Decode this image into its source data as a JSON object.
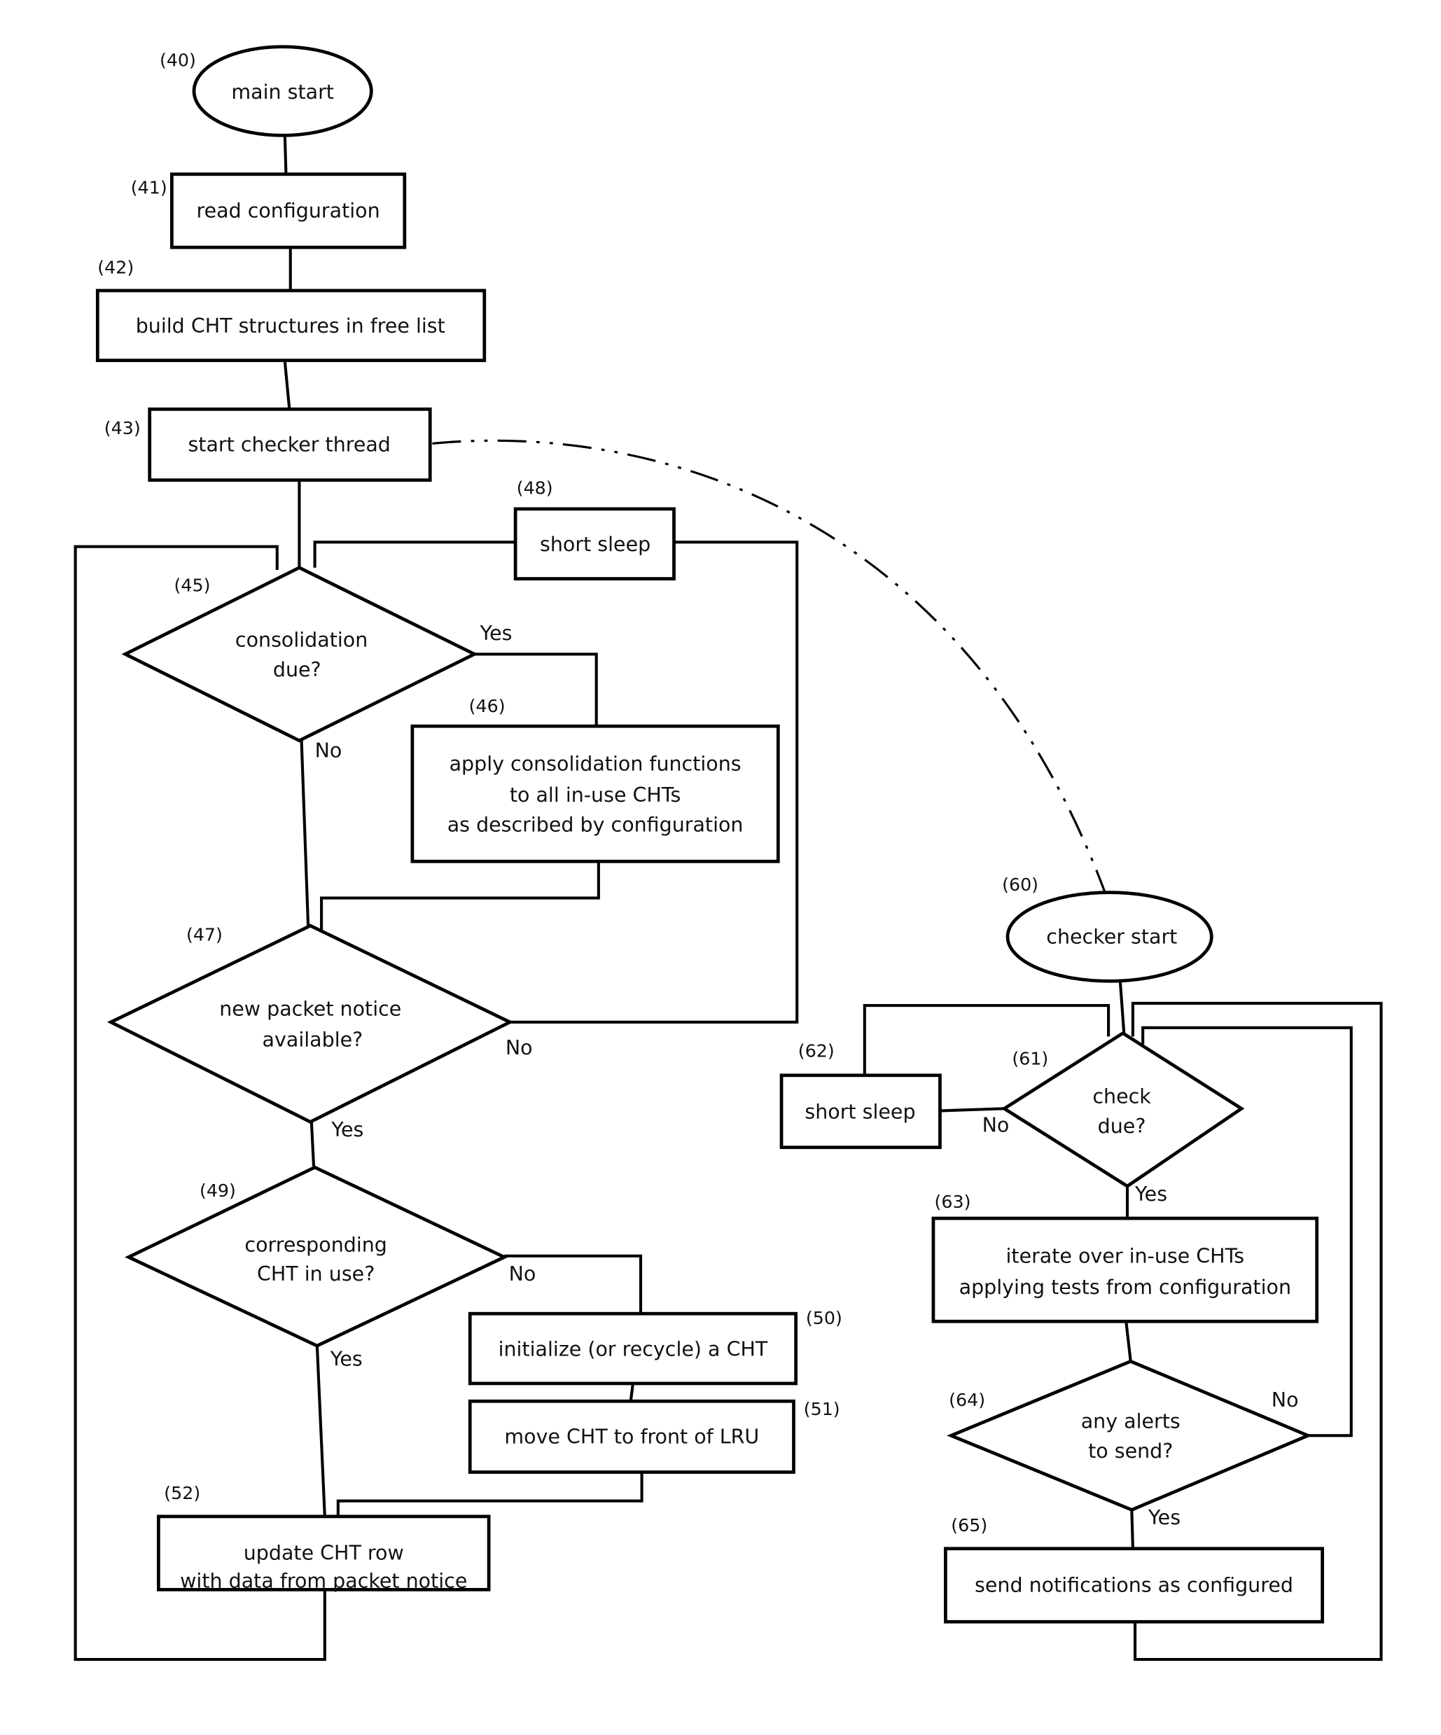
{
  "diagram": {
    "type": "flowchart",
    "main_thread": {
      "n40": {
        "ref": "(40)",
        "lines": [
          "main start"
        ],
        "shape": "ellipse"
      },
      "n41": {
        "ref": "(41)",
        "lines": [
          "read configuration"
        ],
        "shape": "process"
      },
      "n42": {
        "ref": "(42)",
        "lines": [
          "build CHT structures in free list"
        ],
        "shape": "process"
      },
      "n43": {
        "ref": "(43)",
        "lines": [
          "start checker thread"
        ],
        "shape": "process"
      },
      "n45": {
        "ref": "(45)",
        "lines": [
          "consolidation",
          "due?"
        ],
        "shape": "decision",
        "yes": "Yes",
        "no": "No"
      },
      "n46": {
        "ref": "(46)",
        "lines": [
          "apply consolidation functions",
          "to all in-use CHTs",
          "as described by configuration"
        ],
        "shape": "process"
      },
      "n47": {
        "ref": "(47)",
        "lines": [
          "new packet notice",
          "available?"
        ],
        "shape": "decision",
        "yes": "Yes",
        "no": "No"
      },
      "n48": {
        "ref": "(48)",
        "lines": [
          "short sleep"
        ],
        "shape": "process"
      },
      "n49": {
        "ref": "(49)",
        "lines": [
          "corresponding",
          "CHT in use?"
        ],
        "shape": "decision",
        "yes": "Yes",
        "no": "No"
      },
      "n50": {
        "ref": "(50)",
        "lines": [
          "initialize (or recycle) a CHT"
        ],
        "shape": "process"
      },
      "n51": {
        "ref": "(51)",
        "lines": [
          "move CHT to front of LRU"
        ],
        "shape": "process"
      },
      "n52": {
        "ref": "(52)",
        "lines": [
          "update CHT row",
          "with data from packet notice"
        ],
        "shape": "process"
      }
    },
    "checker_thread": {
      "n60": {
        "ref": "(60)",
        "lines": [
          "checker start"
        ],
        "shape": "ellipse"
      },
      "n61": {
        "ref": "(61)",
        "lines": [
          "check",
          "due?"
        ],
        "shape": "decision",
        "yes": "Yes",
        "no": "No"
      },
      "n62": {
        "ref": "(62)",
        "lines": [
          "short sleep"
        ],
        "shape": "process"
      },
      "n63": {
        "ref": "(63)",
        "lines": [
          "iterate over in-use CHTs",
          "applying tests from configuration"
        ],
        "shape": "process"
      },
      "n64": {
        "ref": "(64)",
        "lines": [
          "any alerts",
          "to send?"
        ],
        "shape": "decision",
        "yes": "Yes",
        "no": "No"
      },
      "n65": {
        "ref": "(65)",
        "lines": [
          "send notifications as configured"
        ],
        "shape": "process"
      }
    },
    "edges": [
      {
        "from": "n40",
        "to": "n41"
      },
      {
        "from": "n41",
        "to": "n42"
      },
      {
        "from": "n42",
        "to": "n43"
      },
      {
        "from": "n43",
        "to": "n45"
      },
      {
        "from": "n43",
        "to": "n60",
        "style": "dash-dot",
        "meaning": "spawns thread"
      },
      {
        "from": "n45",
        "to": "n46",
        "label": "Yes"
      },
      {
        "from": "n45",
        "to": "n47",
        "label": "No"
      },
      {
        "from": "n46",
        "to": "n47"
      },
      {
        "from": "n47",
        "to": "n48",
        "label": "No"
      },
      {
        "from": "n48",
        "to": "n45"
      },
      {
        "from": "n47",
        "to": "n49",
        "label": "Yes"
      },
      {
        "from": "n49",
        "to": "n50",
        "label": "No"
      },
      {
        "from": "n50",
        "to": "n51"
      },
      {
        "from": "n51",
        "to": "n52"
      },
      {
        "from": "n49",
        "to": "n52",
        "label": "Yes"
      },
      {
        "from": "n52",
        "to": "n45"
      },
      {
        "from": "n60",
        "to": "n61"
      },
      {
        "from": "n61",
        "to": "n62",
        "label": "No"
      },
      {
        "from": "n62",
        "to": "n61"
      },
      {
        "from": "n61",
        "to": "n63",
        "label": "Yes"
      },
      {
        "from": "n63",
        "to": "n64"
      },
      {
        "from": "n64",
        "to": "n61",
        "label": "No"
      },
      {
        "from": "n64",
        "to": "n65",
        "label": "Yes"
      },
      {
        "from": "n65",
        "to": "n61"
      }
    ]
  }
}
